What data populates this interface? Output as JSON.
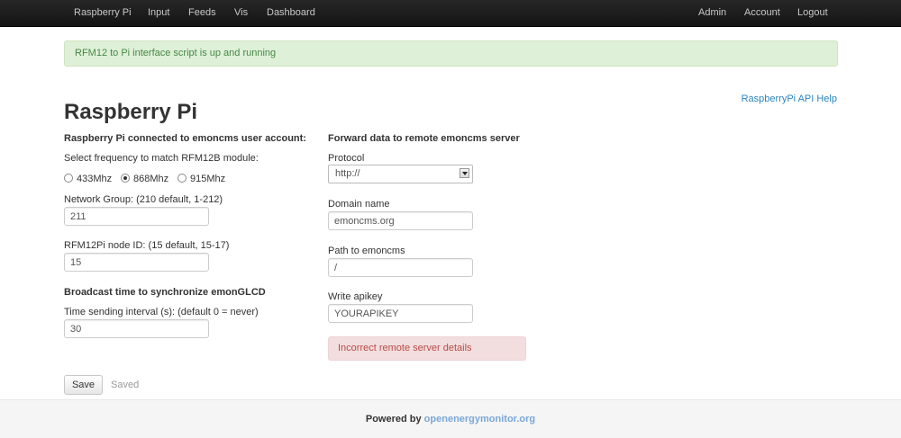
{
  "navbar": {
    "left_items": [
      "Raspberry Pi",
      "Input",
      "Feeds",
      "Vis",
      "Dashboard"
    ],
    "right_items": [
      "Admin",
      "Account",
      "Logout"
    ]
  },
  "status_alert": "RFM12 to Pi interface script is up and running",
  "help_link": "RaspberryPi API Help",
  "page_title": "Raspberry Pi",
  "left_section": {
    "title": "Raspberry Pi connected to emoncms user account:",
    "frequency_label": "Select frequency to match RFM12B module:",
    "frequency_options": [
      "433Mhz",
      "868Mhz",
      "915Mhz"
    ],
    "selected_frequency": "868Mhz",
    "network_group_label": "Network Group: (210 default, 1-212)",
    "network_group_value": "211",
    "node_id_label": "RFM12Pi node ID: (15 default, 15-17)",
    "node_id_value": "15",
    "broadcast_title": "Broadcast time to synchronize emonGLCD",
    "interval_label": "Time sending interval (s): (default 0 = never)",
    "interval_value": "30"
  },
  "right_section": {
    "title": "Forward data to remote emoncms server",
    "protocol_label": "Protocol",
    "protocol_value": "http://",
    "domain_label": "Domain name",
    "domain_value": "emoncms.org",
    "path_label": "Path to emoncms",
    "path_value": "/",
    "apikey_label": "Write apikey",
    "apikey_value": "YOURAPIKEY",
    "error_message": "Incorrect remote server details"
  },
  "actions": {
    "save_label": "Save",
    "saved_status": "Saved"
  },
  "footer": {
    "prefix": "Powered by",
    "link": "openenergymonitor.org"
  },
  "colors": {
    "navbar_bg": "#1b1b1b",
    "success_bg": "#dff0d8",
    "success_text": "#468847",
    "error_bg": "#f2dede",
    "error_text": "#b94a48",
    "link": "#2a85c0"
  },
  "icons": {
    "select_arrow": "chevron-down-icon"
  }
}
